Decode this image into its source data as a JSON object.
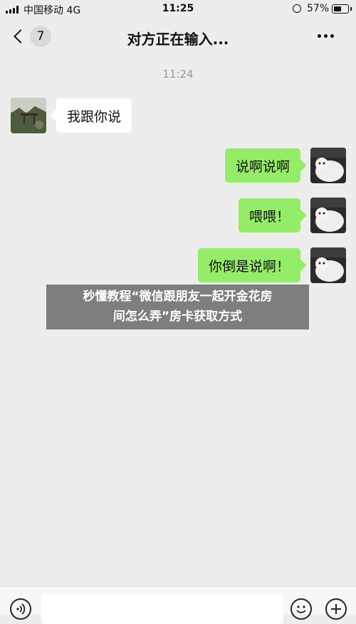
{
  "status_bar": {
    "carrier": "中国移动",
    "network": "4G",
    "time": "11:25",
    "battery_percent": "57%",
    "battery_level": 0.57
  },
  "header": {
    "back_icon": "chevron-left-icon",
    "unread_count": "7",
    "title": "对方正在输入...",
    "more_icon": "more-dots-icon"
  },
  "timestamp": "11:24",
  "messages": [
    {
      "sender": "contact",
      "text": "我跟你说"
    },
    {
      "sender": "me",
      "text": "说啊说啊"
    },
    {
      "sender": "me",
      "text": "喂喂！"
    },
    {
      "sender": "me",
      "text": "你倒是说啊！"
    }
  ],
  "overlay_caption": {
    "line1": "秒懂教程“微信跟朋友一起开金花房",
    "line2": "间怎么弄”房卡获取方式"
  },
  "input_bar": {
    "voice_icon": "voice-icon",
    "input_value": "",
    "emoji_icon": "emoji-icon",
    "plus_icon": "plus-icon"
  },
  "colors": {
    "background": "#ededed",
    "outgoing_bubble": "#95ec69",
    "incoming_bubble": "#ffffff",
    "timestamp": "#9a9a9a"
  }
}
